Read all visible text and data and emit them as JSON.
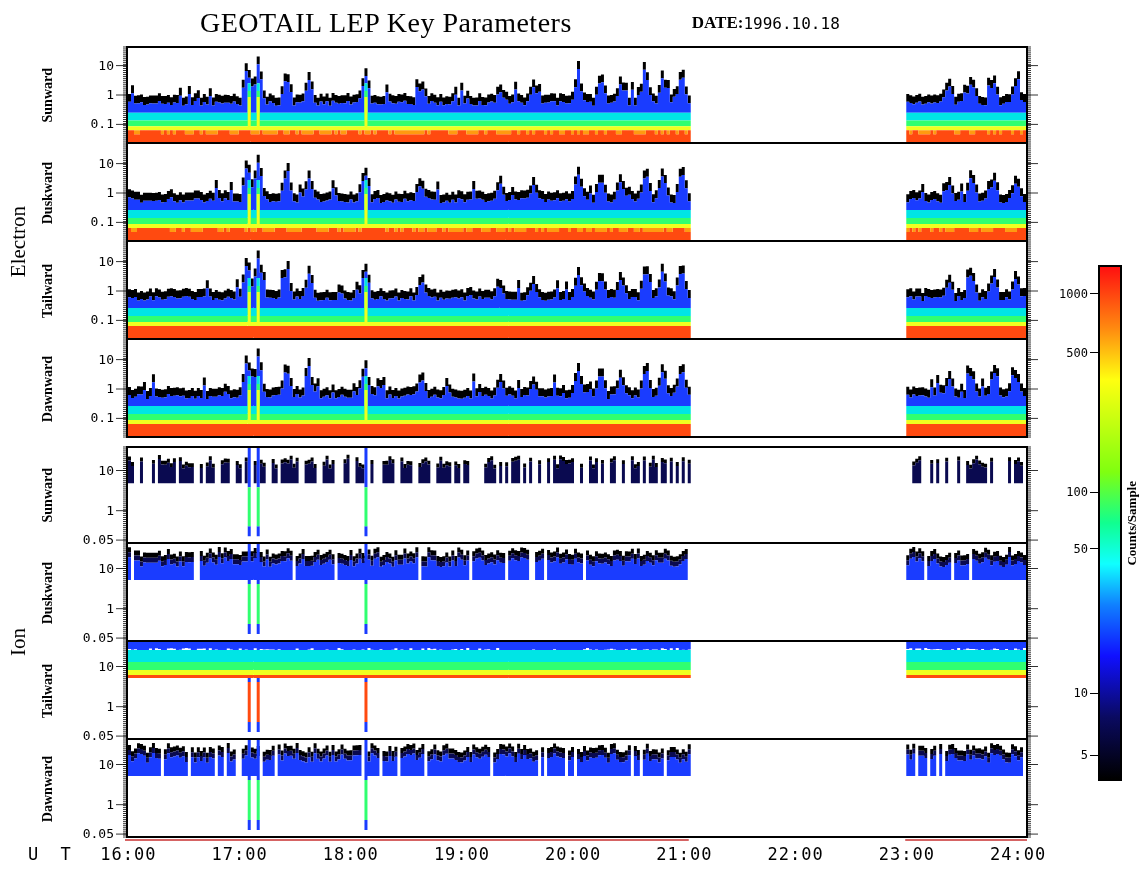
{
  "title": "GEOTAIL LEP Key Parameters",
  "date": {
    "label": "DATE:",
    "value": "1996.10.18"
  },
  "groups": [
    {
      "label": "Electron",
      "kind": "electron",
      "panels": [
        {
          "label": "Sunward",
          "yticks": [
            "10",
            "1",
            "0.1"
          ]
        },
        {
          "label": "Duskward",
          "yticks": [
            "10",
            "1",
            "0.1"
          ]
        },
        {
          "label": "Tailward",
          "yticks": [
            "10",
            "1",
            "0.1"
          ]
        },
        {
          "label": "Dawnward",
          "yticks": [
            "10",
            "1",
            "0.1"
          ]
        }
      ]
    },
    {
      "label": "Ion",
      "kind": "ion",
      "panels": [
        {
          "label": "Sunward",
          "yticks": [
            "10",
            "1",
            "0.05"
          ]
        },
        {
          "label": "Duskward",
          "yticks": [
            "10",
            "1",
            "0.05"
          ]
        },
        {
          "label": "Tailward",
          "yticks": [
            "10",
            "1",
            "0.05"
          ]
        },
        {
          "label": "Dawnward",
          "yticks": [
            "10",
            "1",
            "0.05"
          ]
        }
      ]
    }
  ],
  "colorbar": {
    "title": "Counts/Sample",
    "ticks": [
      "1000",
      "500",
      "100",
      "50",
      "10",
      "5"
    ]
  },
  "time_axis": {
    "label": "U T",
    "ticks": [
      "16:00",
      "17:00",
      "18:00",
      "19:00",
      "20:00",
      "21:00",
      "22:00",
      "23:00",
      "24:00"
    ]
  }
}
